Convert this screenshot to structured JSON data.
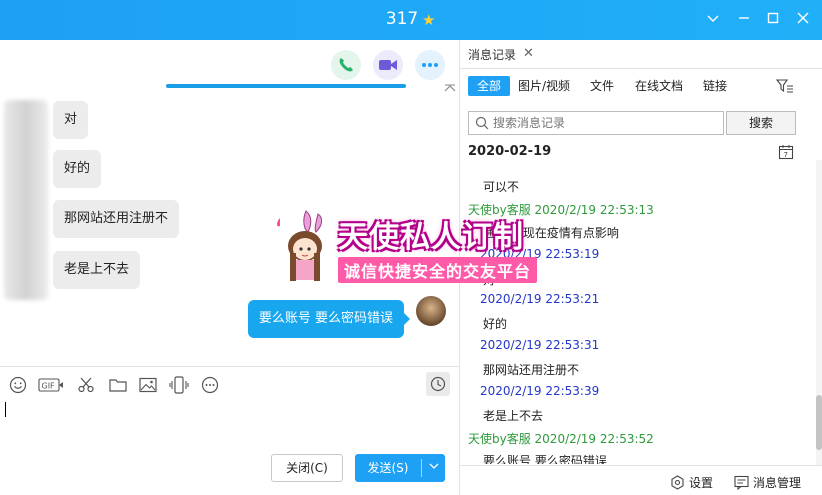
{
  "window": {
    "title": "317",
    "star_icon": "star-icon",
    "controls": [
      "chevron-down-icon",
      "minimize-icon",
      "maximize-icon",
      "close-icon"
    ]
  },
  "chat": {
    "call_buttons": [
      {
        "icon": "phone-icon",
        "color": "#27b36b"
      },
      {
        "icon": "video-icon",
        "color": "#6b5bd6"
      },
      {
        "icon": "more-icon",
        "color": "#1ea0f5"
      }
    ],
    "messages": [
      {
        "side": "left",
        "text": "对"
      },
      {
        "side": "left",
        "text": "好的"
      },
      {
        "side": "left",
        "text": "那网站还用注册不"
      },
      {
        "side": "left",
        "text": "老是上不去"
      },
      {
        "side": "right",
        "text": "要么账号 要么密码错误"
      }
    ],
    "toolbar_icons": [
      "emoji-icon",
      "gif-icon",
      "scissors-icon",
      "folder-icon",
      "image-icon",
      "phone-shake-icon",
      "more-icon"
    ],
    "history_icon": "clock-icon",
    "close_button": "关闭(C)",
    "send_button": "发送(S)"
  },
  "watermark": {
    "line1": "天使私人订制",
    "line2": "诚信快捷安全的交友平台"
  },
  "history": {
    "tab_label": "消息记录",
    "filters": [
      "全部",
      "图片/视频",
      "文件",
      "在线文档",
      "链接"
    ],
    "active_filter": "全部",
    "search_placeholder": "搜索消息记录",
    "search_button": "搜索",
    "date": "2020-02-19",
    "entries": [
      {
        "kind": "msg",
        "text": "可以不"
      },
      {
        "kind": "meta-green",
        "text": "天使by客服 2020/2/19 22:53:13"
      },
      {
        "kind": "msg",
        "text": "通知你 现在疫情有点影响"
      },
      {
        "kind": "meta-blue",
        "text": "2020/2/19 22:53:19"
      },
      {
        "kind": "msg",
        "text": "对"
      },
      {
        "kind": "meta-blue",
        "text": "2020/2/19 22:53:21"
      },
      {
        "kind": "msg",
        "text": "好的"
      },
      {
        "kind": "meta-blue",
        "text": "2020/2/19 22:53:31"
      },
      {
        "kind": "msg",
        "text": "那网站还用注册不"
      },
      {
        "kind": "meta-blue",
        "text": "2020/2/19 22:53:39"
      },
      {
        "kind": "msg",
        "text": "老是上不去"
      },
      {
        "kind": "meta-green",
        "text": "天使by客服 2020/2/19 22:53:52"
      },
      {
        "kind": "msg",
        "text": "要么账号 要么密码错误"
      }
    ],
    "footer": {
      "settings": "设置",
      "manage": "消息管理"
    }
  }
}
